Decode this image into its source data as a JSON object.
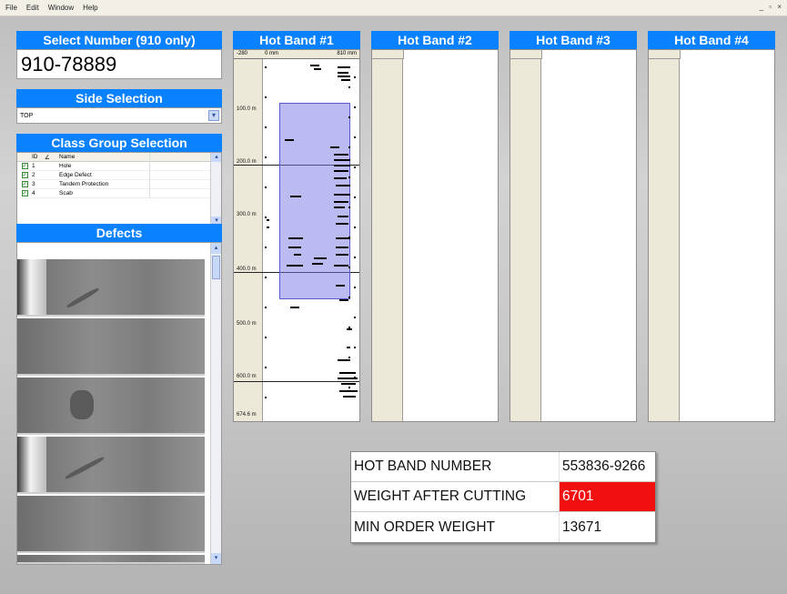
{
  "menu": {
    "items": [
      "File",
      "Edit",
      "Window",
      "Help"
    ],
    "window_controls": "_ ▫ ×"
  },
  "select_number": {
    "title": "Select Number (910 only)",
    "value": "910-78889"
  },
  "side_selection": {
    "title": "Side Selection",
    "selected": "TOP"
  },
  "class_group": {
    "title": "Class Group Selection",
    "columns": [
      "ID",
      "∠",
      "Name"
    ],
    "rows": [
      {
        "id": "1",
        "name": "Hole",
        "checked": true
      },
      {
        "id": "2",
        "name": "Edge Defect",
        "checked": true
      },
      {
        "id": "3",
        "name": "Tandem Protection",
        "checked": true
      },
      {
        "id": "4",
        "name": "Scab",
        "checked": true
      }
    ]
  },
  "defects": {
    "title": "Defects",
    "image_count": 6
  },
  "hot_bands": [
    {
      "title": "Hot Band #1"
    },
    {
      "title": "Hot Band #2"
    },
    {
      "title": "Hot Band #3"
    },
    {
      "title": "Hot Band #4"
    }
  ],
  "hot_band_1": {
    "col_header_left": "-280",
    "col_header_mid": "0 mm",
    "col_header_right": "810 mm",
    "ticks": [
      "100.0 m",
      "200.0 m",
      "300.0 m",
      "400.0 m",
      "500.0 m",
      "600.0 m",
      "674.6 m"
    ]
  },
  "info": {
    "rows": [
      {
        "label": "HOT BAND NUMBER",
        "value": "553836-9266",
        "highlight": false
      },
      {
        "label": "WEIGHT AFTER CUTTING",
        "value": "6701",
        "highlight": true
      },
      {
        "label": "MIN ORDER WEIGHT",
        "value": "13671",
        "highlight": false
      }
    ]
  },
  "colors": {
    "header_blue": "#0a82ff",
    "alert_red": "#f20f0f",
    "selection_purple": "#7878e6"
  }
}
